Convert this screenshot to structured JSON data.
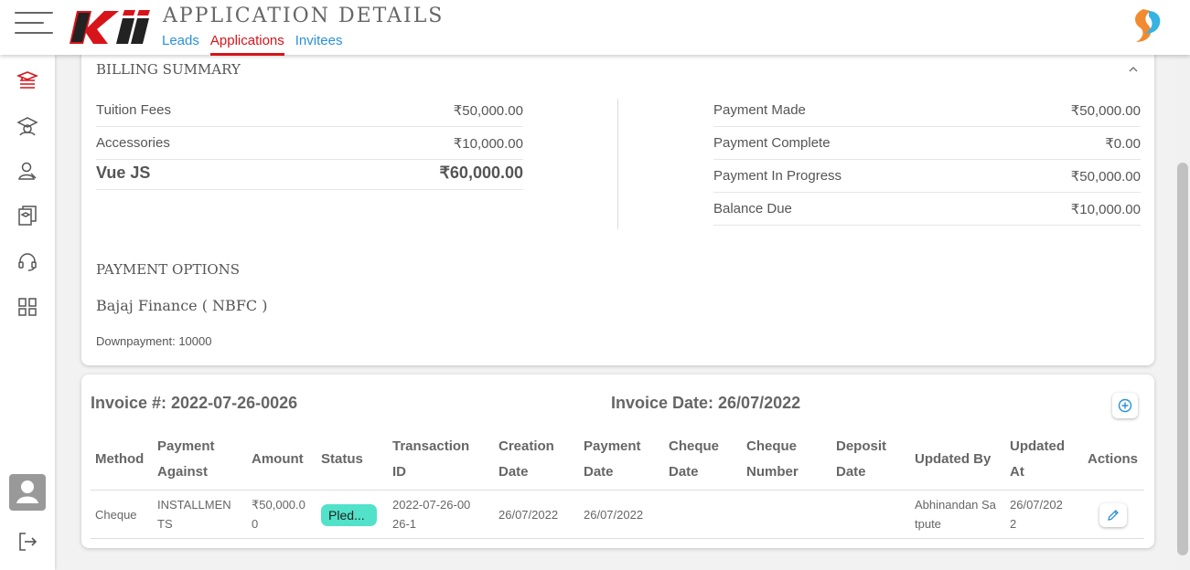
{
  "header": {
    "title": "APPLICATION DETAILS",
    "logo_text": "Kii",
    "tabs": [
      {
        "label": "Leads",
        "active": false
      },
      {
        "label": "Applications",
        "active": true
      },
      {
        "label": "Invitees",
        "active": false
      }
    ]
  },
  "sidebar": {
    "icons": [
      "courses-icon",
      "graduate-icon",
      "user-icon",
      "library-icon",
      "headset-icon",
      "apps-grid-icon"
    ],
    "bottom_icons": [
      "avatar",
      "logout-icon"
    ]
  },
  "billing_summary": {
    "title": "BILLING SUMMARY",
    "left": [
      {
        "label": "Tuition Fees",
        "value": "₹50,000.00"
      },
      {
        "label": "Accessories",
        "value": "₹10,000.00"
      },
      {
        "label": "Vue JS",
        "value": "₹60,000.00"
      }
    ],
    "right": [
      {
        "label": "Payment Made",
        "value": "₹50,000.00"
      },
      {
        "label": "Payment Complete",
        "value": "₹0.00"
      },
      {
        "label": "Payment In Progress",
        "value": "₹50,000.00"
      },
      {
        "label": "Balance Due",
        "value": "₹10,000.00"
      }
    ]
  },
  "payment_options": {
    "title": "PAYMENT OPTIONS",
    "finance": "Bajaj Finance ( NBFC )",
    "downpayment": "Downpayment: 10000"
  },
  "invoice": {
    "number_label": "Invoice #: 2022-07-26-0026",
    "date_label": "Invoice Date: 26/07/2022",
    "columns": [
      [
        "Method"
      ],
      [
        "Payment",
        "Against"
      ],
      [
        "Amount"
      ],
      [
        "Status"
      ],
      [
        "Transaction",
        "ID"
      ],
      [
        "Creation",
        "Date"
      ],
      [
        "Payment",
        "Date"
      ],
      [
        "Cheque",
        "Date"
      ],
      [
        "Cheque",
        "Number"
      ],
      [
        "Deposit",
        "Date"
      ],
      [
        "Updated By"
      ],
      [
        "Updated",
        "At"
      ],
      [
        "Actions"
      ]
    ],
    "rows": [
      {
        "method": "Cheque",
        "payment_against": [
          "INSTALLMEN",
          "TS"
        ],
        "amount": [
          "₹50,000.0",
          "0"
        ],
        "status": "Pled...",
        "transaction_id": [
          "2022-07-26-00",
          "26-1"
        ],
        "creation_date": "26/07/2022",
        "payment_date": "26/07/2022",
        "cheque_date": "",
        "cheque_number": "",
        "deposit_date": "",
        "updated_by": [
          "Abhinandan Sa",
          "tpute"
        ],
        "updated_at": [
          "26/07/202",
          "2"
        ]
      }
    ]
  },
  "colors": {
    "accent_red": "#d7141a",
    "link_blue": "#2a90d9",
    "status_teal": "#52e2c9"
  }
}
